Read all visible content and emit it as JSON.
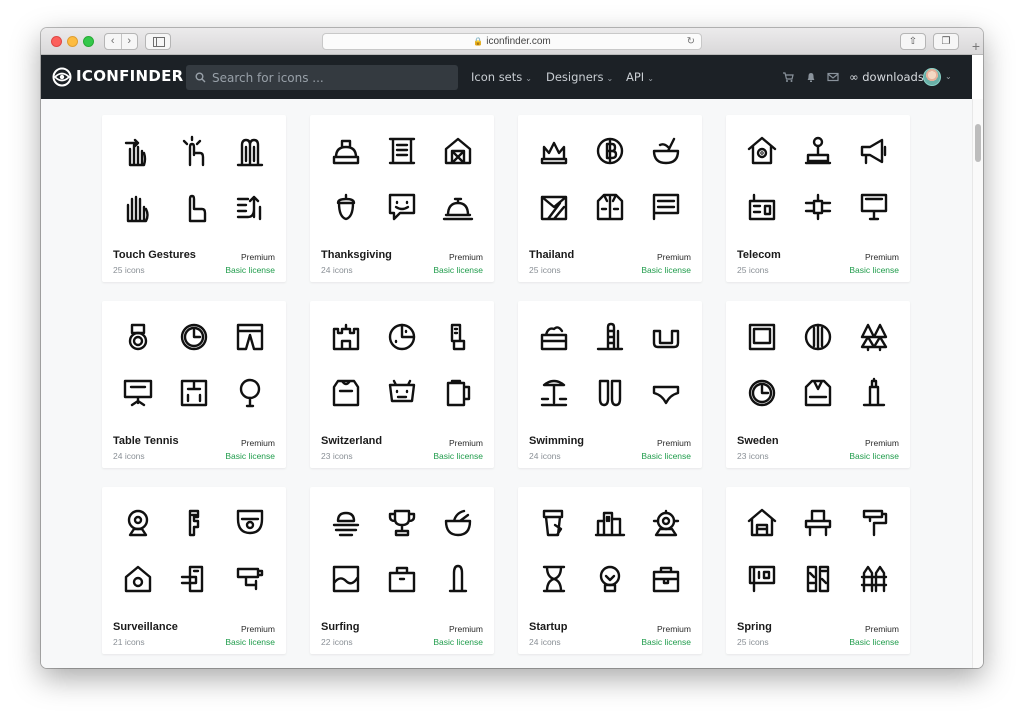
{
  "browser": {
    "url": "iconfinder.com",
    "back_glyph": "‹",
    "forward_glyph": "›",
    "lock_glyph": "🔒",
    "reload_glyph": "↻",
    "share_glyph": "⇧",
    "tabs_glyph": "❐",
    "plus_glyph": "+"
  },
  "nav": {
    "logo": "ICONFINDER",
    "search_placeholder": "Search for icons ...",
    "menu": [
      "Icon sets",
      "Designers",
      "API"
    ],
    "chevron": "⌄",
    "downloads": "∞ downloads",
    "icons": [
      "cart-icon",
      "bell-icon",
      "mail-icon"
    ]
  },
  "colors": {
    "nav_bg": "#1c2126",
    "license_green": "#1f9c4b",
    "page_bg": "#f7f8f9"
  },
  "cards": [
    {
      "title": "Touch Gestures",
      "count": "25 icons",
      "tier": "Premium",
      "license": "Basic license",
      "icons": [
        "swipe-right-hand-icon",
        "tap-hand-icon",
        "two-finger-hand-icon",
        "hand-spread-icon",
        "point-hand-icon",
        "swipe-up-hand-icon"
      ]
    },
    {
      "title": "Thanksgiving",
      "count": "24 icons",
      "tier": "Premium",
      "license": "Basic license",
      "icons": [
        "pie-icon",
        "scroll-icon",
        "barn-icon",
        "acorn-icon",
        "chat-smile-icon",
        "cloche-icon"
      ]
    },
    {
      "title": "Thailand",
      "count": "25 icons",
      "tier": "Premium",
      "license": "Basic license",
      "icons": [
        "crown-icon",
        "baht-coin-icon",
        "coconut-drink-icon",
        "scarf-icon",
        "jacket-icon",
        "flag-icon"
      ]
    },
    {
      "title": "Telecom",
      "count": "25 icons",
      "tier": "Premium",
      "license": "Basic license",
      "icons": [
        "house-signal-icon",
        "antenna-icon",
        "megaphone-icon",
        "radio-icon",
        "satellite-icon",
        "monitor-icon"
      ]
    },
    {
      "title": "Table Tennis",
      "count": "24 icons",
      "tier": "Premium",
      "license": "Basic license",
      "icons": [
        "medal-icon",
        "clock-icon",
        "shorts-icon",
        "board-icon",
        "scoreboard-icon",
        "paddle-icon"
      ]
    },
    {
      "title": "Switzerland",
      "count": "23 icons",
      "tier": "Premium",
      "license": "Basic license",
      "icons": [
        "castle-icon",
        "cheese-icon",
        "knife-icon",
        "jersey-icon",
        "cow-icon",
        "mug-icon"
      ]
    },
    {
      "title": "Swimming",
      "count": "24 icons",
      "tier": "Premium",
      "license": "Basic license",
      "icons": [
        "pool-icon",
        "ladder-icon",
        "goggles-icon",
        "beach-icon",
        "flippers-icon",
        "swimsuit-icon"
      ]
    },
    {
      "title": "Sweden",
      "count": "23 icons",
      "tier": "Premium",
      "license": "Basic license",
      "icons": [
        "frame-icon",
        "shield-icon",
        "trees-icon",
        "clock-icon",
        "sweater-icon",
        "lighthouse-icon"
      ]
    },
    {
      "title": "Surveillance",
      "count": "21 icons",
      "tier": "Premium",
      "license": "Basic license",
      "icons": [
        "webcam-icon",
        "key-icon",
        "dome-camera-icon",
        "house-camera-icon",
        "card-reader-icon",
        "cctv-icon"
      ]
    },
    {
      "title": "Surfing",
      "count": "22 icons",
      "tier": "Premium",
      "license": "Basic license",
      "icons": [
        "sunset-icon",
        "trophy-icon",
        "bowl-icon",
        "wave-frame-icon",
        "bag-icon",
        "surfboard-icon"
      ]
    },
    {
      "title": "Startup",
      "count": "24 icons",
      "tier": "Premium",
      "license": "Basic license",
      "icons": [
        "coffee-cup-icon",
        "buildings-icon",
        "robot-icon",
        "hourglass-icon",
        "lightbulb-icon",
        "briefcase-icon"
      ]
    },
    {
      "title": "Spring",
      "count": "25 icons",
      "tier": "Premium",
      "license": "Basic license",
      "icons": [
        "house-icon",
        "bench-icon",
        "paint-roller-icon",
        "sign-icon",
        "plants-icon",
        "fence-icon"
      ]
    }
  ]
}
